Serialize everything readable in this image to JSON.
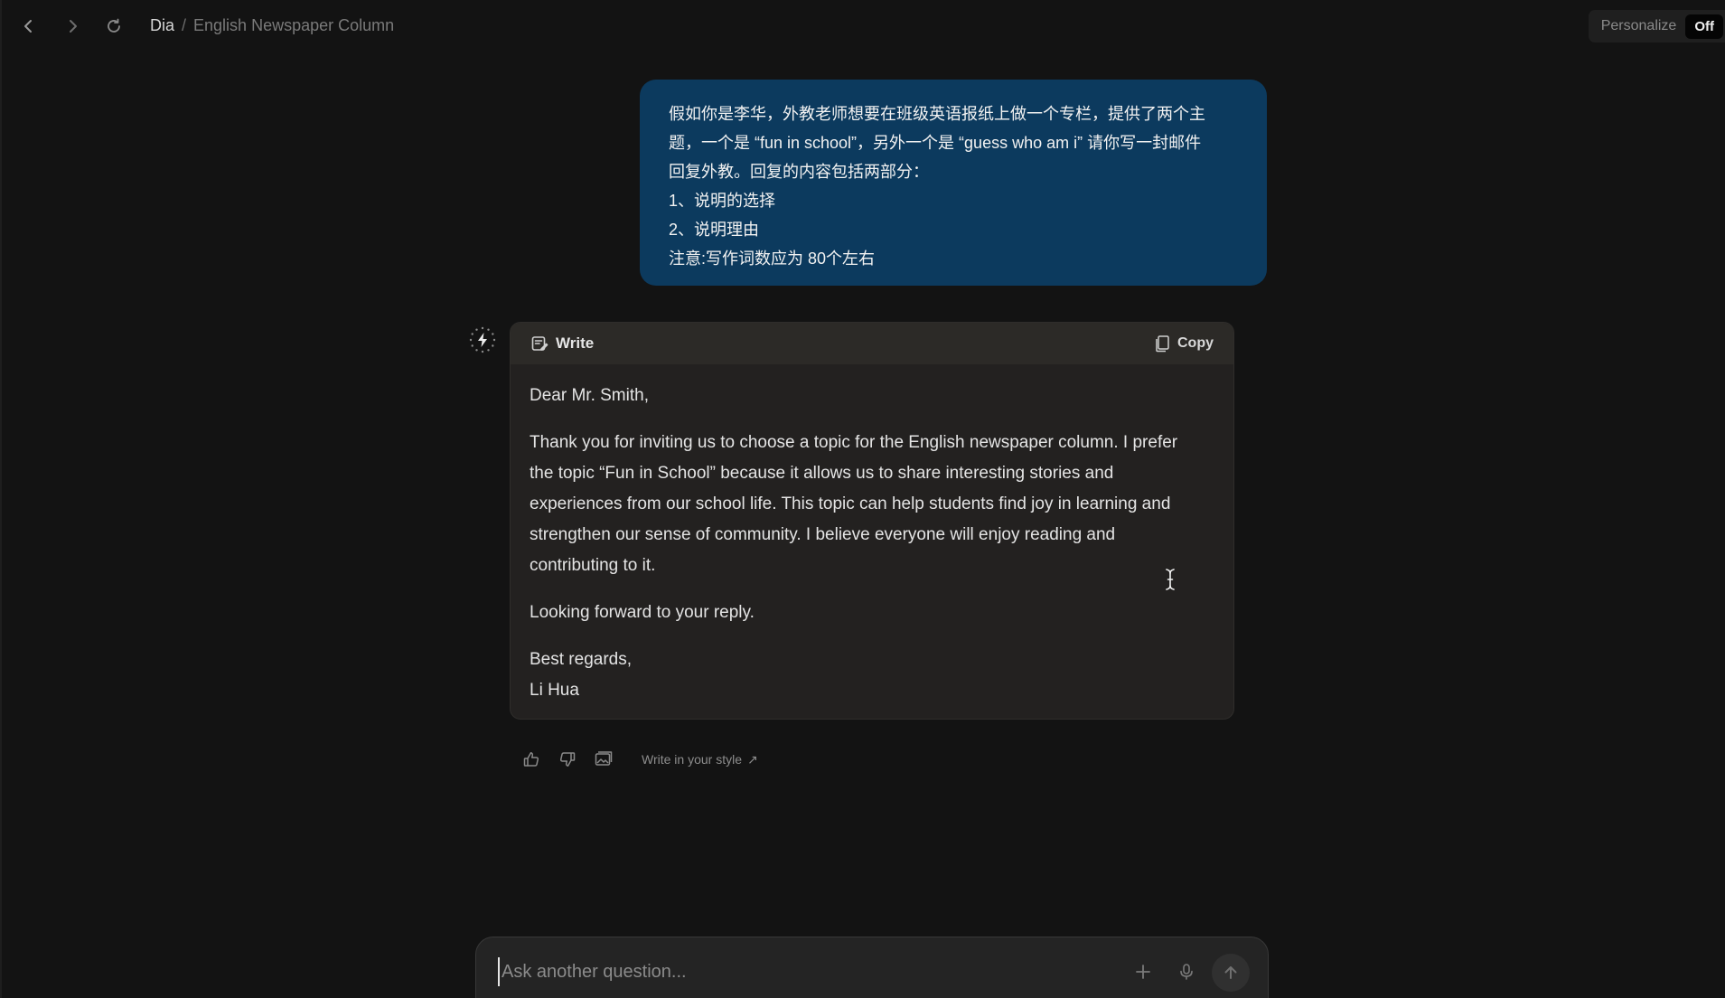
{
  "nav": {
    "back_icon": "chevron-left-icon",
    "forward_icon": "chevron-right-icon",
    "reload_icon": "reload-icon"
  },
  "breadcrumb": {
    "root": "Dia",
    "separator": "/",
    "current": "English Newspaper Column"
  },
  "personalize": {
    "label": "Personalize",
    "state": "Off"
  },
  "user_message": {
    "lines": [
      "假如你是李华，外教老师想要在班级英语报纸上做一个专栏，提供了两个主",
      "题，一个是 “fun in school”，另外一个是 “guess who am i” 请你写一封邮件",
      "回复外教。回复的内容包括两部分：",
      "1、说明的选择",
      "2、说明理由",
      "注意:写作词数应为 80个左右"
    ]
  },
  "response": {
    "title": "Write",
    "copy_label": "Copy",
    "greeting": "Dear Mr. Smith,",
    "body": "Thank you for inviting us to choose a topic for the English newspaper column. I prefer the topic “Fun in School” because it allows us to share interesting stories and experiences from our school life. This topic can help students find joy in learning and strengthen our sense of community. I believe everyone will enjoy reading and contributing to it.",
    "closing": "Looking forward to your reply.",
    "signoff": "Best regards,",
    "signature": "Li Hua"
  },
  "feedback": {
    "icons": [
      "thumbs-up-icon",
      "thumbs-down-icon",
      "gallery-icon"
    ],
    "style_link": "Write in your style",
    "style_link_arrow": "↗"
  },
  "composer": {
    "placeholder": "Ask another question...",
    "value": ""
  },
  "colors": {
    "background": "#131313",
    "user_bubble": "#0c3a5e",
    "card": "#232120",
    "card_header": "#2c2a27",
    "composer": "#242424"
  }
}
